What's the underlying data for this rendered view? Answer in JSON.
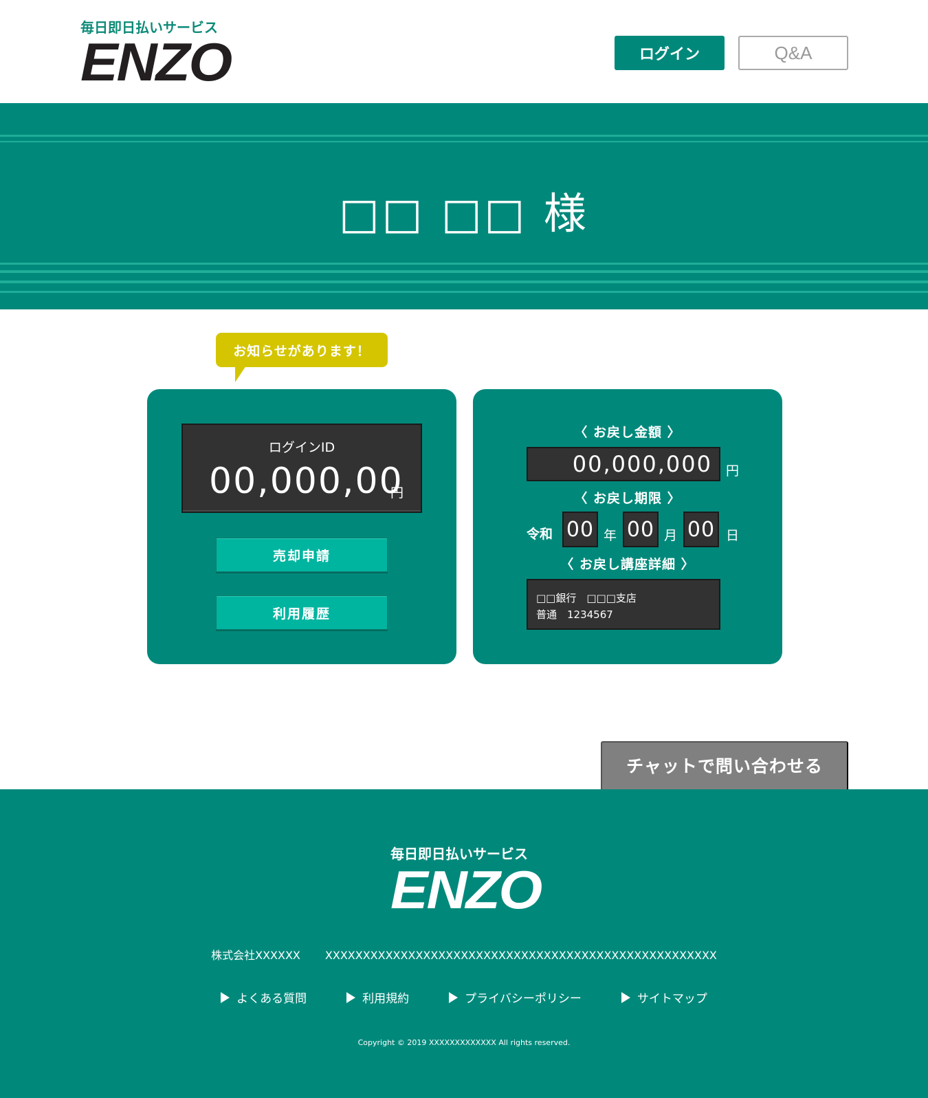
{
  "header": {
    "tagline": "毎日即日払いサービス",
    "brand": "ENZO",
    "login_label": "ログイン",
    "qa_label": "Q&A"
  },
  "hero": {
    "user_name": "□□ □□ 様"
  },
  "notice": {
    "label": "お知らせがあります！"
  },
  "account_card": {
    "id_label": "ログインID",
    "id_value": "00,000,00",
    "unit": "円",
    "sell_button": "売却申請",
    "history_button": "利用履歴"
  },
  "refund_card": {
    "amount_label": "〈 お戻し金額 〉",
    "amount_value": "00,000,000",
    "amount_unit": "円",
    "deadline_label": "〈 お戻し期限 〉",
    "era": "令和",
    "year": "00",
    "year_unit": "年",
    "month": "00",
    "month_unit": "月",
    "day": "00",
    "day_unit": "日",
    "account_label": "〈 お戻し講座詳細 〉",
    "bank_line1": "□□銀行　□□□支店",
    "bank_line2": "普通　1234567"
  },
  "chat": {
    "label": "チャットで問い合わせる"
  },
  "footer": {
    "tagline": "毎日即日払いサービス",
    "brand": "ENZO",
    "company": "株式会社XXXXXX",
    "address": "XXXXXXXXXXXXXXXXXXXXXXXXXXXXXXXXXXXXXXXXXXXXXXXXXXXX",
    "links": [
      "よくある質問",
      "利用規約",
      "プライバシーポリシー",
      "サイトマップ"
    ],
    "copyright": "Copyright © 2019 XXXXXXXXXXXXX All rights reserved."
  },
  "colors": {
    "primary": "#00897b",
    "accent_button": "#00b5a0",
    "notice": "#d4c500",
    "dark_box": "#323232",
    "chat": "#808080"
  }
}
